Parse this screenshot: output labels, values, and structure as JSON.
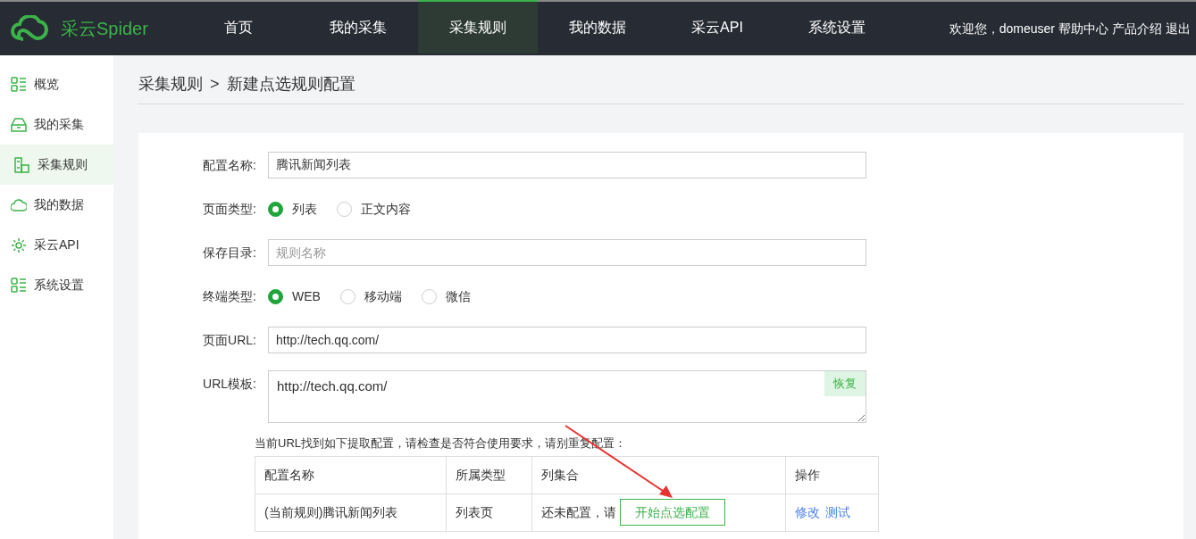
{
  "brand": {
    "name": "采云Spider"
  },
  "nav": [
    {
      "label": "首页",
      "selected": false
    },
    {
      "label": "我的采集",
      "selected": false
    },
    {
      "label": "采集规则",
      "selected": true
    },
    {
      "label": "我的数据",
      "selected": false
    },
    {
      "label": "采云API",
      "selected": false
    },
    {
      "label": "系统设置",
      "selected": false
    }
  ],
  "user_links": {
    "welcome": "欢迎您，domeuser",
    "links": [
      "帮助中心",
      "产品介绍",
      "退出"
    ]
  },
  "sidebar": {
    "items": [
      {
        "label": "概览",
        "selected": false
      },
      {
        "label": "我的采集",
        "selected": false
      },
      {
        "label": "采集规则",
        "selected": true
      },
      {
        "label": "我的数据",
        "selected": false
      },
      {
        "label": "采云API",
        "selected": false
      },
      {
        "label": "系统设置",
        "selected": false
      }
    ]
  },
  "breadcrumb": {
    "parent": "采集规则",
    "separator": ">",
    "current": "新建点选规则配置"
  },
  "form": [
    {
      "kind": "text",
      "label": "配置名称:",
      "value": "腾讯新闻列表"
    },
    {
      "kind": "radio",
      "label": "页面类型:",
      "options": [
        {
          "label": "列表",
          "selected": true
        },
        {
          "label": "正文内容",
          "selected": false
        }
      ]
    },
    {
      "kind": "text",
      "label": "保存目录:",
      "placeholder": "规则名称"
    },
    {
      "kind": "radio",
      "label": "终端类型:",
      "options": [
        {
          "label": "WEB",
          "selected": true
        },
        {
          "label": "移动端",
          "selected": false
        },
        {
          "label": "微信",
          "selected": false
        }
      ]
    },
    {
      "kind": "text",
      "label": "页面URL:",
      "value": "http://tech.qq.com/"
    },
    {
      "kind": "textarea",
      "label": "URL模板:",
      "value": "http://tech.qq.com/",
      "button": "恢复"
    }
  ],
  "notice": "当前URL找到如下提取配置，请检查是否符合使用要求，请别重复配置：",
  "table": {
    "columns": [
      "配置名称",
      "所属类型",
      "列集合",
      "操作"
    ],
    "rows": [
      {
        "name": "(当前规则)腾讯新闻列表",
        "type": "列表页",
        "columns_text": "还未配置，请",
        "columns_button": "开始点选配置",
        "actions": [
          "修改",
          "测试"
        ]
      }
    ]
  }
}
